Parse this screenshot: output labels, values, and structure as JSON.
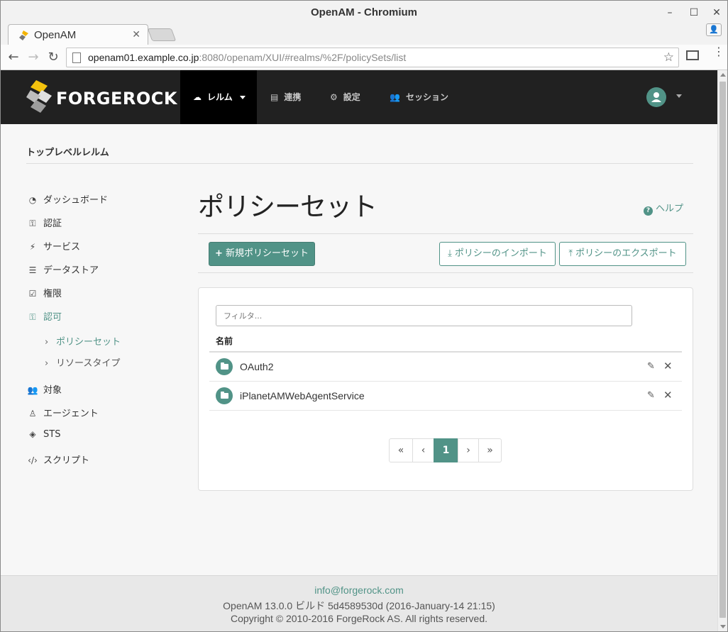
{
  "window": {
    "title": "OpenAM - Chromium"
  },
  "browser": {
    "tab_label": "OpenAM",
    "url_host": "openam01.example.co.jp",
    "url_rest": ":8080/openam/XUI/#realms/%2F/policySets/list"
  },
  "header": {
    "brand": "FORGEROCK",
    "nav": [
      {
        "label": "レルム",
        "icon": "cloud-icon"
      },
      {
        "label": "連携",
        "icon": "book-icon"
      },
      {
        "label": "設定",
        "icon": "gear-icon"
      },
      {
        "label": "セッション",
        "icon": "users-icon"
      }
    ]
  },
  "realm": {
    "title": "トップレベルレルム"
  },
  "sidebar": {
    "items": [
      {
        "label": "ダッシュボード",
        "icon": "dashboard-icon"
      },
      {
        "label": "認証",
        "icon": "key-icon"
      },
      {
        "label": "サービス",
        "icon": "plug-icon"
      },
      {
        "label": "データストア",
        "icon": "database-icon"
      },
      {
        "label": "権限",
        "icon": "checkbox-icon"
      },
      {
        "label": "認可",
        "icon": "key-icon"
      },
      {
        "label": "対象",
        "icon": "users-icon"
      },
      {
        "label": "エージェント",
        "icon": "person-icon"
      },
      {
        "label": "STS",
        "icon": "tag-icon"
      },
      {
        "label": "スクリプト",
        "icon": "code-icon"
      }
    ],
    "subitems": [
      {
        "label": "ポリシーセット"
      },
      {
        "label": "リソースタイプ"
      }
    ]
  },
  "main": {
    "title": "ポリシーセット",
    "help_label": "ヘルプ",
    "new_button": "新規ポリシーセット",
    "import_button": "ポリシーのインポート",
    "export_button": "ポリシーのエクスポート",
    "filter_placeholder": "フィルタ...",
    "column_name": "名前",
    "rows": [
      {
        "name": "OAuth2"
      },
      {
        "name": "iPlanetAMWebAgentService"
      }
    ],
    "pagination": {
      "first": "«",
      "prev": "‹",
      "current": "1",
      "next": "›",
      "last": "»"
    }
  },
  "footer": {
    "email": "info@forgerock.com",
    "build": "OpenAM 13.0.0 ビルド 5d4589530d (2016-January-14 21:15)",
    "copyright": "Copyright © 2010-2016 ForgeRock AS. All rights reserved."
  },
  "colors": {
    "accent": "#519387",
    "header_bg": "#212121"
  }
}
